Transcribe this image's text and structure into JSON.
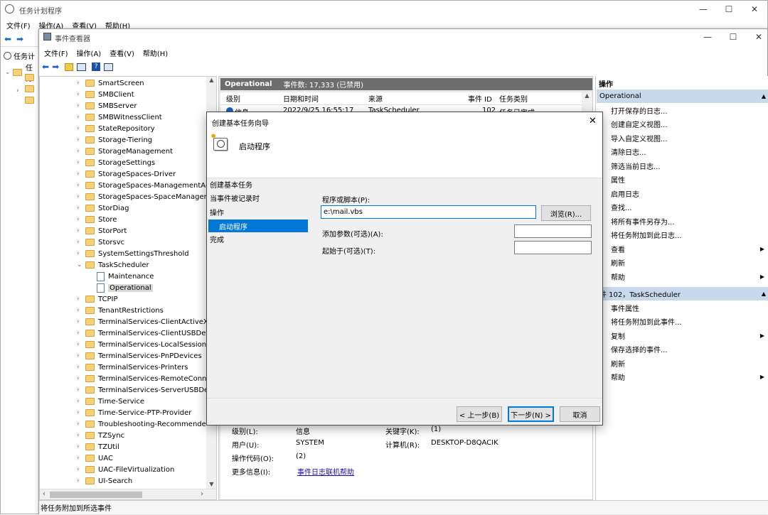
{
  "task_scheduler": {
    "title": "任务计划程序",
    "menu": [
      "文件(F)",
      "操作(A)",
      "查看(V)",
      "帮助(H)"
    ],
    "tree_root": "任务计",
    "tree_sub": "任务"
  },
  "event_viewer": {
    "title": "事件查看器",
    "menu": [
      "文件(F)",
      "操作(A)",
      "查看(V)",
      "帮助(H)"
    ],
    "tree": [
      {
        "label": "SmartScreen",
        "type": "folder"
      },
      {
        "label": "SMBClient",
        "type": "folder"
      },
      {
        "label": "SMBServer",
        "type": "folder"
      },
      {
        "label": "SMBWitnessClient",
        "type": "folder"
      },
      {
        "label": "StateRepository",
        "type": "folder"
      },
      {
        "label": "Storage-Tiering",
        "type": "folder"
      },
      {
        "label": "StorageManagement",
        "type": "folder"
      },
      {
        "label": "StorageSettings",
        "type": "folder"
      },
      {
        "label": "StorageSpaces-Driver",
        "type": "folder"
      },
      {
        "label": "StorageSpaces-ManagementAge",
        "type": "folder"
      },
      {
        "label": "StorageSpaces-SpaceManager",
        "type": "folder"
      },
      {
        "label": "StorDiag",
        "type": "folder"
      },
      {
        "label": "Store",
        "type": "folder"
      },
      {
        "label": "StorPort",
        "type": "folder"
      },
      {
        "label": "Storsvc",
        "type": "folder"
      },
      {
        "label": "SystemSettingsThreshold",
        "type": "folder"
      },
      {
        "label": "TaskScheduler",
        "type": "folder-open"
      },
      {
        "label": "Maintenance",
        "type": "log"
      },
      {
        "label": "Operational",
        "type": "log-selected"
      },
      {
        "label": "TCPIP",
        "type": "folder"
      },
      {
        "label": "TenantRestrictions",
        "type": "folder"
      },
      {
        "label": "TerminalServices-ClientActiveXCc",
        "type": "folder"
      },
      {
        "label": "TerminalServices-ClientUSBDevic",
        "type": "folder"
      },
      {
        "label": "TerminalServices-LocalSessionM",
        "type": "folder"
      },
      {
        "label": "TerminalServices-PnPDevices",
        "type": "folder"
      },
      {
        "label": "TerminalServices-Printers",
        "type": "folder"
      },
      {
        "label": "TerminalServices-RemoteConnec",
        "type": "folder"
      },
      {
        "label": "TerminalServices-ServerUSBDevi",
        "type": "folder"
      },
      {
        "label": "Time-Service",
        "type": "folder"
      },
      {
        "label": "Time-Service-PTP-Provider",
        "type": "folder"
      },
      {
        "label": "Troubleshooting-Recommended",
        "type": "folder"
      },
      {
        "label": "TZSync",
        "type": "folder"
      },
      {
        "label": "TZUtil",
        "type": "folder"
      },
      {
        "label": "UAC",
        "type": "folder"
      },
      {
        "label": "UAC-FileVirtualization",
        "type": "folder"
      },
      {
        "label": "UI-Search",
        "type": "folder"
      }
    ],
    "log_header": {
      "name": "Operational",
      "count": "事件数: 17,333 (已禁用)"
    },
    "columns": [
      "级别",
      "日期和时间",
      "来源",
      "事件 ID",
      "任务类别"
    ],
    "first_row": {
      "level": "信息",
      "date": "2022/9/25 16:55:17",
      "source": "TaskScheduler",
      "id": "102",
      "category": "任务已完成"
    },
    "details": {
      "level_label": "级别(L):",
      "level_value": "信息",
      "keyword_label": "关键字(K):",
      "keyword_value": "(1)",
      "user_label": "用户(U):",
      "user_value": "SYSTEM",
      "computer_label": "计算机(R):",
      "computer_value": "DESKTOP-D8QACIK",
      "opcode_label": "操作代码(O):",
      "opcode_value": "(2)",
      "more_label": "更多信息(I):",
      "more_link": "事件日志联机帮助"
    },
    "status": "将任务附加到所选事件",
    "actions_title": "操作",
    "section1": "Operational",
    "actions1": [
      {
        "label": "打开保存的日志...",
        "arrow": false
      },
      {
        "label": "创建自定义视图...",
        "arrow": false
      },
      {
        "label": "导入自定义视图...",
        "arrow": false
      },
      {
        "label": "清除日志...",
        "arrow": false
      },
      {
        "label": "筛选当前日志...",
        "arrow": false
      },
      {
        "label": "属性",
        "arrow": false
      },
      {
        "label": "启用日志",
        "arrow": false
      },
      {
        "label": "查找...",
        "arrow": false
      },
      {
        "label": "将所有事件另存为...",
        "arrow": false
      },
      {
        "label": "将任务附加到此日志...",
        "arrow": false
      },
      {
        "label": "查看",
        "arrow": true
      },
      {
        "label": "刷新",
        "arrow": false
      },
      {
        "label": "帮助",
        "arrow": true
      }
    ],
    "section2": "件 102，TaskScheduler",
    "actions2": [
      {
        "label": "事件属性",
        "arrow": false
      },
      {
        "label": "将任务附加到此事件...",
        "arrow": false
      },
      {
        "label": "复制",
        "arrow": true
      },
      {
        "label": "保存选择的事件...",
        "arrow": false
      },
      {
        "label": "刷新",
        "arrow": false
      },
      {
        "label": "帮助",
        "arrow": true
      }
    ]
  },
  "wizard": {
    "title": "创建基本任务向导",
    "heading": "启动程序",
    "steps": [
      "创建基本任务",
      "当事件被记录时",
      "操作",
      "启动程序",
      "完成"
    ],
    "selected_step": 3,
    "program_label": "程序或脚本(P):",
    "program_value": "e:\\mail.vbs",
    "browse": "浏览(R)...",
    "args_label": "添加参数(可选)(A):",
    "args_value": "",
    "start_label": "起始于(可选)(T):",
    "start_value": "",
    "back": "< 上一步(B)",
    "next": "下一步(N) >",
    "cancel": "取消"
  },
  "colors": {
    "accent": "#0078d7",
    "header_gray": "#6d6d6d",
    "section_blue": "#c9d9ec"
  }
}
